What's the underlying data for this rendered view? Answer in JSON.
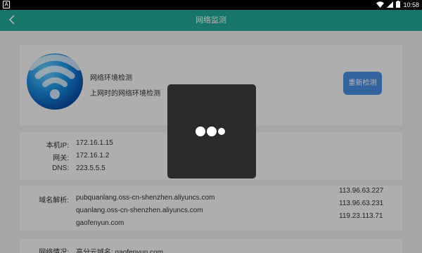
{
  "status_bar": {
    "time": "10:58",
    "left_icon_text": "A",
    "icons": [
      "wifi-icon",
      "signal-icon",
      "battery-icon"
    ]
  },
  "app_bar": {
    "back_icon": "chevron-left-icon",
    "title": "网络监测"
  },
  "env_card": {
    "icon": "wifi-globe-icon",
    "title": "网络环境检测",
    "subtitle": "上网时的网络环境检测",
    "retry_label": "重新检测"
  },
  "network_info": [
    {
      "label": "本机IP:",
      "value": "172.16.1.15"
    },
    {
      "label": "网关:",
      "value": "172.16.1.2"
    },
    {
      "label": "DNS:",
      "value": "223.5.5.5"
    }
  ],
  "dns_resolution": {
    "label": "域名解析:",
    "domains": [
      "pubquanlang.oss-cn-shenzhen.aliyuncs.com",
      "quanlang.oss-cn-shenzhen.aliyuncs.com",
      "gaofenyun.com"
    ],
    "ips": [
      "113.96.63.227",
      "113.96.63.231",
      "119.23.113.71"
    ]
  },
  "network_status": {
    "label": "网络情况:",
    "value": "高分云域名: gaofenyun.com"
  },
  "colors": {
    "app_bar": "#23a897",
    "retry_button": "#4a90e2",
    "dialog": "#2b2b2b"
  }
}
